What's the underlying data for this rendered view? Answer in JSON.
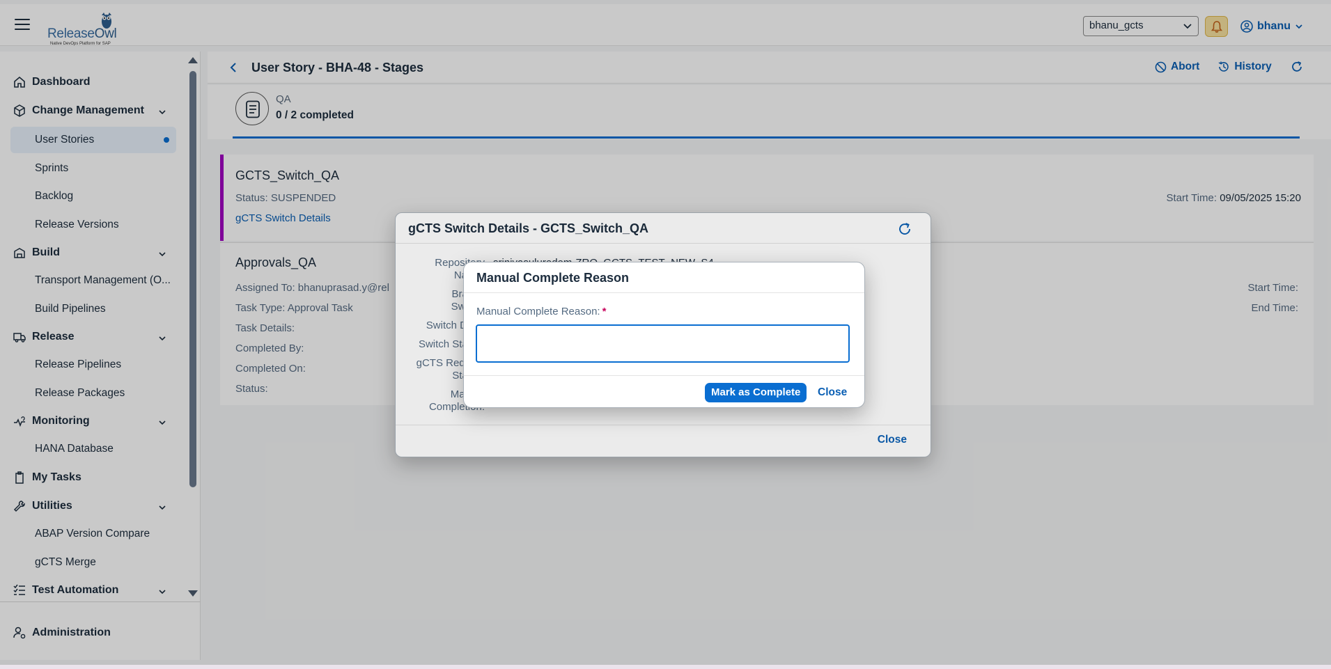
{
  "shell": {
    "logo_name_1": "Release",
    "logo_name_2": "Owl",
    "logo_tagline": "Native DevOps Platform for SAP",
    "system_select": "bhanu_gcts",
    "user_name": "bhanu"
  },
  "sidebar": {
    "dashboard": "Dashboard",
    "change_management": "Change Management",
    "user_stories": "User Stories",
    "sprints": "Sprints",
    "backlog": "Backlog",
    "release_versions": "Release Versions",
    "build": "Build",
    "transport_management": "Transport Management (O...",
    "build_pipelines": "Build Pipelines",
    "release": "Release",
    "release_pipelines": "Release Pipelines",
    "release_packages": "Release Packages",
    "monitoring": "Monitoring",
    "hana_database": "HANA Database",
    "my_tasks": "My Tasks",
    "utilities": "Utilities",
    "abap_version_compare": "ABAP Version Compare",
    "gcts_merge": "gCTS Merge",
    "test_automation": "Test Automation",
    "administration": "Administration"
  },
  "page": {
    "title": "User Story - BHA-48 - Stages",
    "abort": "Abort",
    "history": "History",
    "stage_name": "QA",
    "stage_count": "0 / 2 completed"
  },
  "task1": {
    "title": "GCTS_Switch_QA",
    "status": "Status: SUSPENDED",
    "link": "gCTS Switch Details",
    "start_time_label": "Start Time:",
    "start_time_value": "09/05/2025 15:20"
  },
  "task2": {
    "title": "Approvals_QA",
    "assigned_to": "Assigned To: bhanuprasad.y@rel",
    "task_type": "Task Type: Approval Task",
    "task_details": "Task Details:",
    "completed_by": "Completed By:",
    "completed_on": "Completed On:",
    "status": "Status:",
    "start_time": "Start Time:",
    "end_time": "End Time:"
  },
  "dialog_switch": {
    "title": "gCTS Switch Details - GCTS_Switch_QA",
    "repo_label_1": "Repository",
    "repo_label_2": "Name:",
    "repo_value": "srinivasuluredem-ZRO_GCTS_TEST_NEW_S4",
    "branch_label_1": "Branch",
    "branch_label_2": "Switch:",
    "switch_date_label": "Switch Date:",
    "switch_status_label": "Switch Status:",
    "gcts_label_1": "gCTS Request",
    "gcts_label_2": "Status:",
    "manual_label_1": "Manual",
    "manual_label_2": "Completion:",
    "close": "Close"
  },
  "dialog_reason": {
    "title": "Manual Complete Reason",
    "field_label": "Manual Complete Reason:",
    "required_mark": "*",
    "input_value": "",
    "mark_complete": "Mark as Complete",
    "close": "Close"
  }
}
